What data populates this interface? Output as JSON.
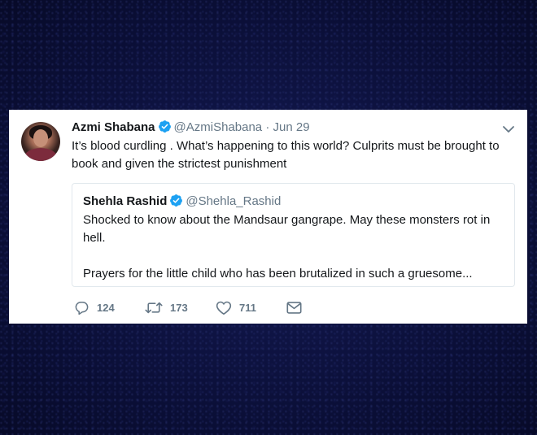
{
  "tweet": {
    "author_name": "Azmi Shabana",
    "author_handle": "@AzmiShabana",
    "separator": "·",
    "date": "Jun 29",
    "text": "It’s blood curdling . What’s happening to this world? Culprits must be brought to book and given the strictest punishment",
    "verified": true
  },
  "quoted_tweet": {
    "author_name": "Shehla Rashid",
    "author_handle": "@Shehla_Rashid",
    "verified": true,
    "line1": "Shocked to know about the Mandsaur gangrape. May these monsters rot in hell.",
    "line2": "Prayers for the little child who has been brutalized in such a gruesome..."
  },
  "actions": {
    "reply_count": "124",
    "retweet_count": "173",
    "like_count": "711"
  },
  "icons": {
    "verified": "verified-badge-icon",
    "menu": "chevron-down-icon",
    "reply": "reply-icon",
    "retweet": "retweet-icon",
    "like": "heart-icon",
    "message": "envelope-icon"
  },
  "colors": {
    "background": "#0d1240",
    "card": "#ffffff",
    "verified": "#1da1f2",
    "secondary_text": "#657786",
    "primary_text": "#14171a"
  }
}
